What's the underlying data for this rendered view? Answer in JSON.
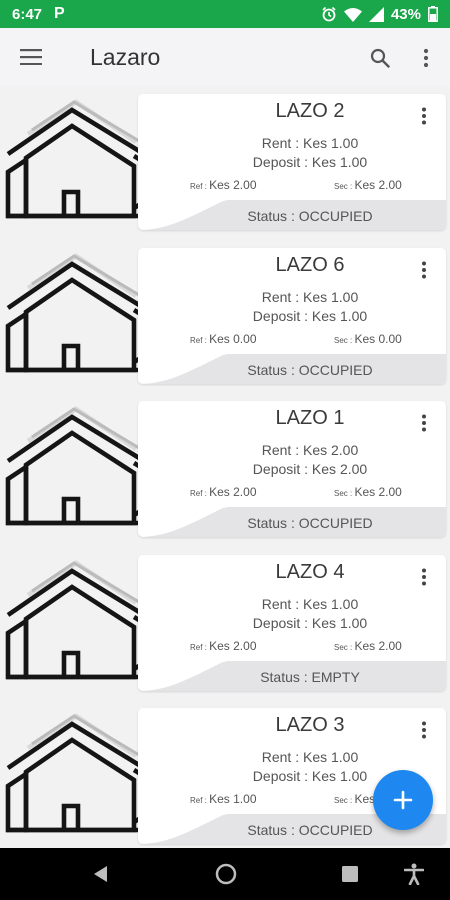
{
  "status_bar": {
    "time": "6:47",
    "notification": "P",
    "battery": "43%"
  },
  "app_bar": {
    "title": "Lazaro"
  },
  "labels": {
    "ref_prefix": "Ref : ",
    "sec_prefix": "Sec : "
  },
  "properties": [
    {
      "name": "LAZO 2",
      "rent": "Rent : Kes 1.00",
      "deposit": "Deposit : Kes 1.00",
      "ref": "Kes 2.00",
      "sec": "Kes 2.00",
      "status": "Status : OCCUPIED"
    },
    {
      "name": "LAZO 6",
      "rent": "Rent : Kes 1.00",
      "deposit": "Deposit : Kes 1.00",
      "ref": "Kes 0.00",
      "sec": "Kes 0.00",
      "status": "Status : OCCUPIED"
    },
    {
      "name": "LAZO 1",
      "rent": "Rent : Kes 2.00",
      "deposit": "Deposit : Kes 2.00",
      "ref": "Kes 2.00",
      "sec": "Kes 2.00",
      "status": "Status : OCCUPIED"
    },
    {
      "name": "LAZO 4",
      "rent": "Rent : Kes 1.00",
      "deposit": "Deposit : Kes 1.00",
      "ref": "Kes 2.00",
      "sec": "Kes 2.00",
      "status": "Status : EMPTY"
    },
    {
      "name": "LAZO 3",
      "rent": "Rent : Kes 1.00",
      "deposit": "Deposit : Kes 1.00",
      "ref": "Kes 1.00",
      "sec": "Kes 1.00",
      "status": "Status : OCCUPIED"
    }
  ],
  "icons": {
    "menu": "menu-icon",
    "search": "search-icon",
    "more": "more-vert-icon",
    "property": "house-icon",
    "add": "add-icon",
    "back": "back-icon",
    "home": "home-icon",
    "recents": "recents-icon",
    "accessibility": "accessibility-icon"
  },
  "colors": {
    "status_bar": "#1aa64a",
    "fab": "#1e88f0",
    "status_strip": "#e4e4e6"
  }
}
